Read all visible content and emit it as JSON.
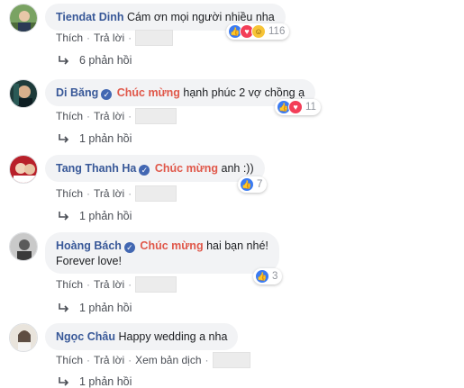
{
  "comments": [
    {
      "author": "Tiendat Dinh",
      "verified": false,
      "mention": "",
      "text": "Cám ơn mọi người nhiều nha",
      "text2": "",
      "reactions": [
        "like",
        "love",
        "haha"
      ],
      "reaction_count": "116",
      "actions": {
        "like": "Thích",
        "reply": "Trả lời",
        "translate": ""
      },
      "replies": "6 phản hồi"
    },
    {
      "author": "Di Băng",
      "verified": true,
      "mention": "Chúc mừng",
      "text": "hạnh phúc 2 vợ chồng ạ",
      "text2": "",
      "reactions": [
        "like",
        "love"
      ],
      "reaction_count": "11",
      "actions": {
        "like": "Thích",
        "reply": "Trả lời",
        "translate": ""
      },
      "replies": "1 phản hồi"
    },
    {
      "author": "Tang Thanh Ha",
      "verified": true,
      "mention": "Chúc mừng",
      "text": "anh :))",
      "text2": "",
      "reactions": [
        "like"
      ],
      "reaction_count": "7",
      "actions": {
        "like": "Thích",
        "reply": "Trả lời",
        "translate": ""
      },
      "replies": "1 phản hồi"
    },
    {
      "author": "Hoàng Bách",
      "verified": true,
      "mention": "Chúc mừng",
      "text": "hai bạn nhé!",
      "text2": "Forever love!",
      "reactions": [
        "like"
      ],
      "reaction_count": "3",
      "actions": {
        "like": "Thích",
        "reply": "Trả lời",
        "translate": ""
      },
      "replies": "1 phản hồi"
    },
    {
      "author": "Ngọc Châu",
      "verified": false,
      "mention": "",
      "text": "Happy wedding a nha",
      "text2": "",
      "reactions": [],
      "reaction_count": "",
      "actions": {
        "like": "Thích",
        "reply": "Trả lời",
        "translate": "Xem bản dịch"
      },
      "replies": "1 phản hồi"
    }
  ],
  "icons": {
    "like": "thumbs-up-icon",
    "love": "heart-icon",
    "haha": "laughing-face-icon",
    "reply": "reply-arrow-icon",
    "verified": "verified-badge-icon"
  },
  "colors": {
    "author": "#385898",
    "mention": "#e0584a",
    "bubble": "#f2f3f5",
    "like": "#3b7bf2",
    "love": "#f33e58",
    "haha": "#f7c437"
  }
}
